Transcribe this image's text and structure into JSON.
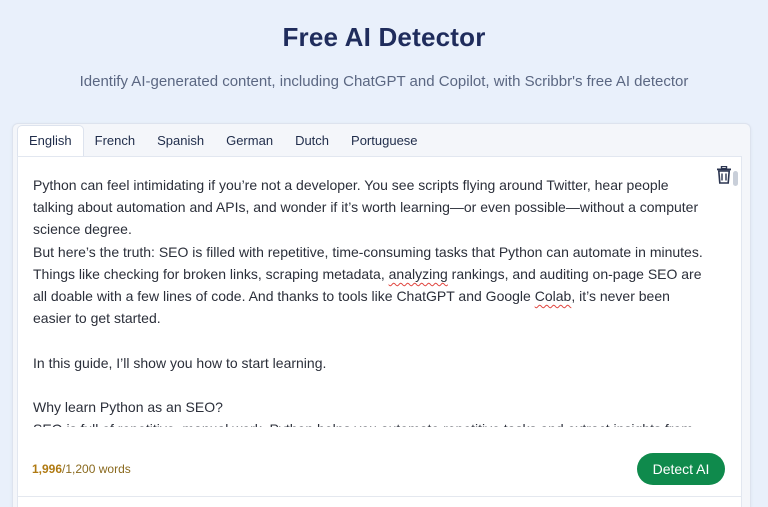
{
  "header": {
    "title": "Free AI Detector",
    "subtitle": "Identify AI-generated content, including ChatGPT and Copilot, with Scribbr's free AI detector"
  },
  "tabs": [
    {
      "label": "English",
      "active": true
    },
    {
      "label": "French",
      "active": false
    },
    {
      "label": "Spanish",
      "active": false
    },
    {
      "label": "German",
      "active": false
    },
    {
      "label": "Dutch",
      "active": false
    },
    {
      "label": "Portuguese",
      "active": false
    }
  ],
  "editor": {
    "paragraphs": {
      "p1": "Python can feel intimidating if you’re not a developer. You see scripts flying around Twitter, hear people talking about automation and APIs, and wonder if it’s worth learning—or even possible—without a computer science degree.",
      "p2": "But here’s the truth: SEO is filled with repetitive, time-consuming tasks that Python can automate in minutes.",
      "p3a": "Things like checking for broken links, scraping metadata,",
      "p3b": "analyzing",
      "p3c": "rankings, and auditing on-page SEO are all doable with a few lines of code. And thanks to tools like ChatGPT and Google",
      "p3d": "Colab",
      "p3e": ", it’s never been easier to get started.",
      "p4": "In this guide, I’ll show you how to start learning.",
      "p5": "Why learn Python as an SEO?",
      "p6": "SEO is full of repetitive, manual work. Python helps you automate repetitive tasks and extract insights from massive"
    }
  },
  "footer": {
    "words_used": "1,996",
    "words_limit": "/1,200 words",
    "detect_label": "Detect AI"
  },
  "colors": {
    "accent_green": "#0f8a4c",
    "title_navy": "#1f2c5c",
    "count_amber": "#b07a12"
  },
  "icons": {
    "delete": "trash-icon"
  }
}
